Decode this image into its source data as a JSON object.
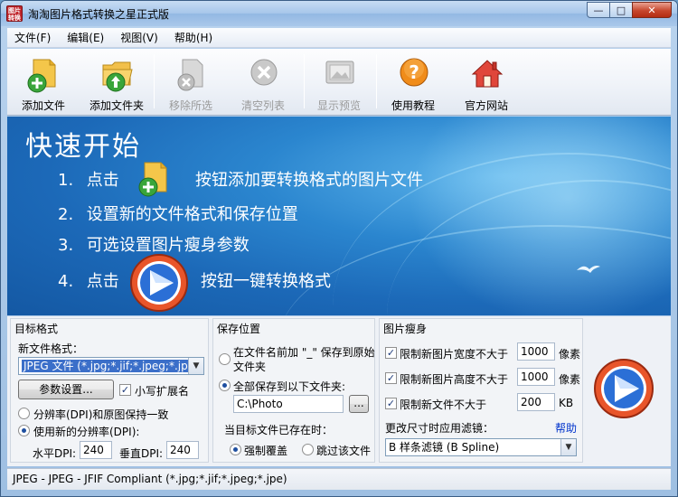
{
  "window": {
    "title": "淘淘图片格式转换之星正式版",
    "icon_text_top": "图片",
    "icon_text_bottom": "转换",
    "minimize": "—",
    "maximize": "□",
    "close": "✕"
  },
  "menu": [
    "文件(F)",
    "编辑(E)",
    "视图(V)",
    "帮助(H)"
  ],
  "toolbar": [
    {
      "label": "添加文件",
      "icon": "add-file-icon",
      "enabled": true
    },
    {
      "label": "添加文件夹",
      "icon": "add-folder-icon",
      "enabled": true
    },
    {
      "label": "移除所选",
      "icon": "remove-selected-icon",
      "enabled": false
    },
    {
      "label": "清空列表",
      "icon": "clear-list-icon",
      "enabled": false
    },
    {
      "label": "显示预览",
      "icon": "preview-icon",
      "enabled": false
    },
    {
      "label": "使用教程",
      "icon": "help-icon",
      "enabled": true
    },
    {
      "label": "官方网站",
      "icon": "home-icon",
      "enabled": true
    }
  ],
  "banner": {
    "title": "快速开始",
    "steps": [
      {
        "num": "1.",
        "pre": "点击",
        "post": "按钮添加要转换格式的图片文件"
      },
      {
        "num": "2.",
        "text": "设置新的文件格式和保存位置"
      },
      {
        "num": "3.",
        "text": "可选设置图片瘦身参数"
      },
      {
        "num": "4.",
        "pre": "点击",
        "post": "按钮一键转换格式"
      }
    ]
  },
  "target": {
    "title": "目标格式",
    "format_label": "新文件格式：",
    "format_value": "JPEG 文件 (*.jpg;*.jif;*.jpeg;*.jpe)",
    "params_button": "参数设置...",
    "lowercase_ext": "小写扩展名",
    "dpi_keep": "分辨率(DPI)和原图保持一致",
    "dpi_new": "使用新的分辨率(DPI):",
    "h_dpi_label": "水平DPI:",
    "h_dpi_value": "240",
    "v_dpi_label": "垂直DPI:",
    "v_dpi_value": "240"
  },
  "save": {
    "title": "保存位置",
    "prefix_option_line1": "在文件名前加 \"_\" 保存到原始",
    "prefix_option_line2": "文件夹",
    "folder_option": "全部保存到以下文件夹:",
    "folder_value": "C:\\Photo",
    "browse": "...",
    "exists_label": "当目标文件已存在时：",
    "overwrite": "强制覆盖",
    "skip": "跳过该文件"
  },
  "slim": {
    "title": "图片瘦身",
    "width_label": "限制新图片宽度不大于",
    "width_value": "1000",
    "width_unit": "像素",
    "height_label": "限制新图片高度不大于",
    "height_value": "1000",
    "height_unit": "像素",
    "size_label": "限制新文件不大于",
    "size_value": "200",
    "size_unit": "KB",
    "filter_label": "更改尺寸时应用滤镜：",
    "help": "帮助",
    "filter_value": "B 样条滤镜 (B Spline)"
  },
  "status": "JPEG - JPEG - JFIF Compliant (*.jpg;*.jif;*.jpeg;*.jpe)"
}
